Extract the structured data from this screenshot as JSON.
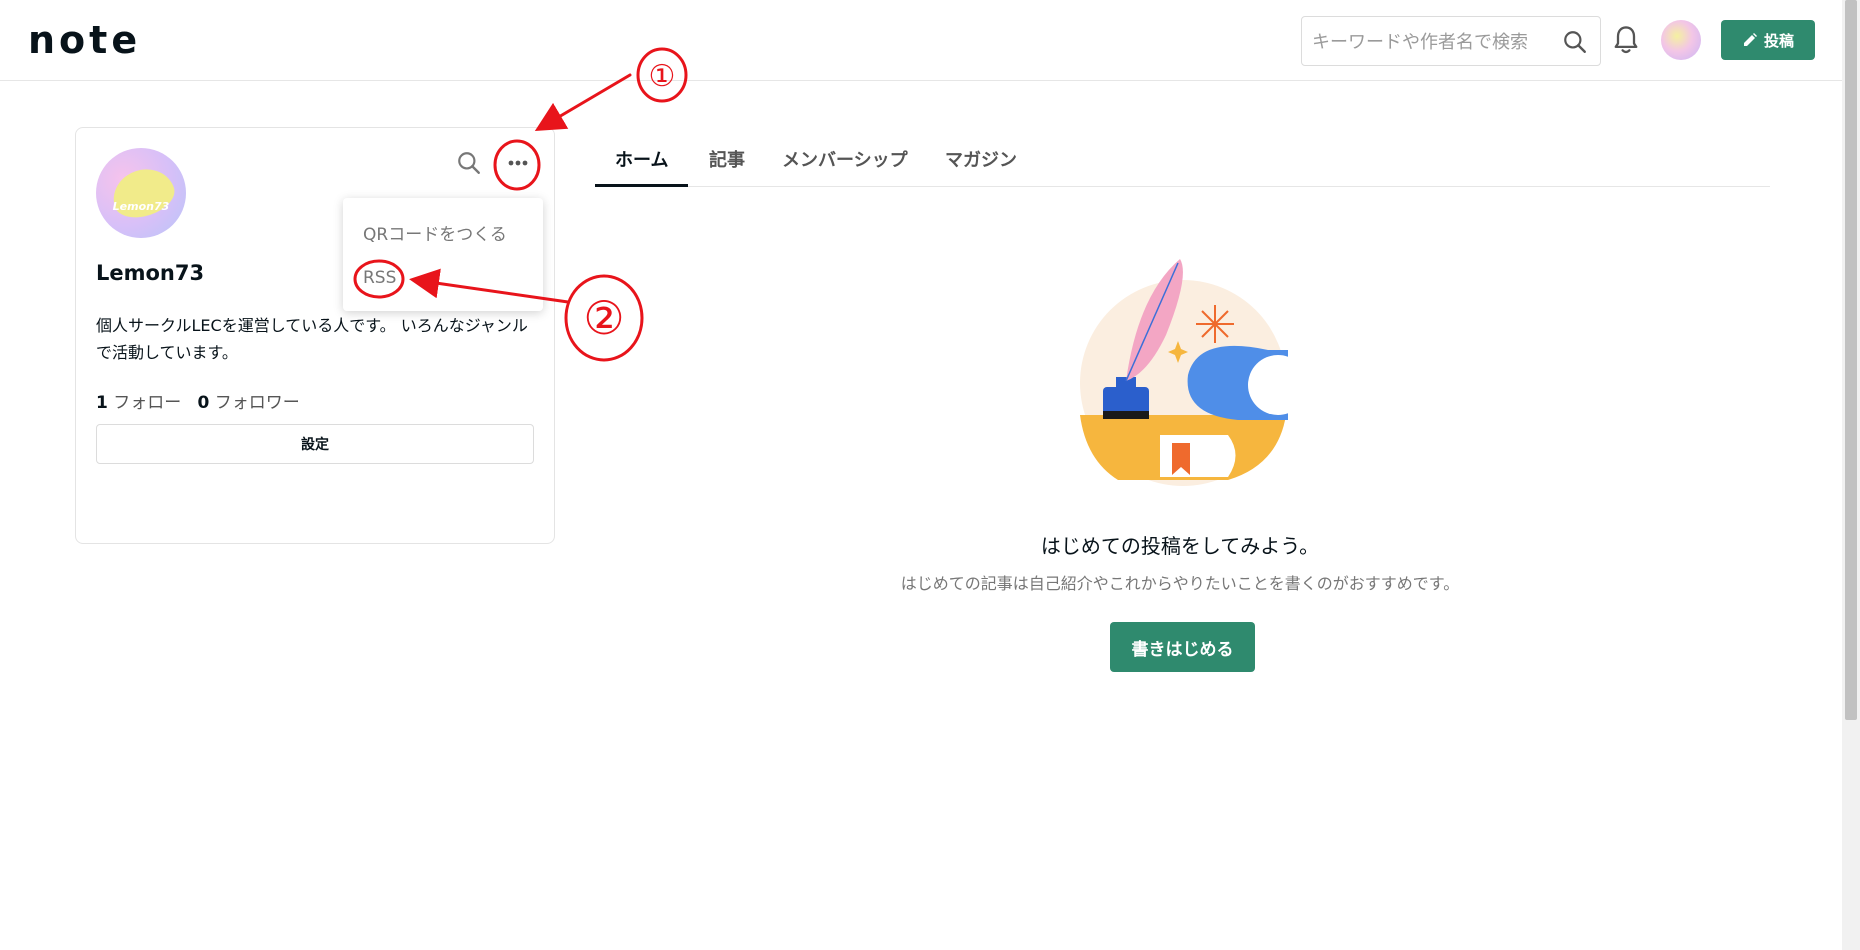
{
  "header": {
    "logo": "note",
    "search_placeholder": "キーワードや作者名で検索",
    "post_button": "投稿"
  },
  "profile": {
    "avatar_text": "Lemon73",
    "name": "Lemon73",
    "bio": "個人サークルLECを運営している人です。 いろんなジャンルで活動しています。",
    "following_count": "1",
    "following_label": "フォロー",
    "follower_count": "0",
    "follower_label": "フォロワー",
    "settings_button": "設定"
  },
  "dropdown": {
    "items": [
      "QRコードをつくる",
      "RSS"
    ]
  },
  "tabs": [
    {
      "label": "ホーム",
      "active": true
    },
    {
      "label": "記事",
      "active": false
    },
    {
      "label": "メンバーシップ",
      "active": false
    },
    {
      "label": "マガジン",
      "active": false
    }
  ],
  "empty_state": {
    "title": "はじめての投稿をしてみよう。",
    "description": "はじめての記事は自己紹介やこれからやりたいことを書くのがおすすめです。",
    "button": "書きはじめる"
  },
  "annotations": {
    "label_1": "①",
    "label_2": "②",
    "color": "#e8141b"
  },
  "colors": {
    "brand_green": "#2f8a6e",
    "text_primary": "#08131a"
  }
}
